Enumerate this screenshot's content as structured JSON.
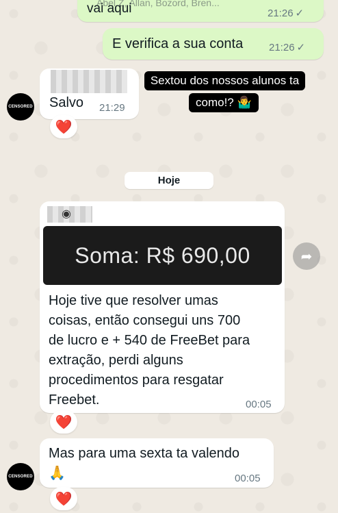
{
  "chat": {
    "top_partial": {
      "names": "Abel Z, Allan, Bozord, Bren...",
      "text": "vai aqui",
      "time": "21:26"
    },
    "out_message": {
      "text": "E verifica a sua conta",
      "time": "21:26"
    },
    "salvo_message": {
      "text": "Salvo",
      "time": "21:29",
      "reaction": "❤️"
    },
    "caption_overlay": {
      "line1": "Sextou dos nossos alunos ta",
      "line2": "como!? 🤷‍♂️"
    },
    "date_divider": "Hoje",
    "media_message": {
      "media_text": "Soma:  R$ 690,00",
      "text_lines": [
        "Hoje tive que resolver umas",
        "coisas, então consegui uns 700",
        "de lucro e + 540 de FreeBet para",
        "extração, perdi alguns",
        "procedimentos para resgatar",
        "Freebet."
      ],
      "time": "00:05",
      "reaction": "❤️"
    },
    "last_message": {
      "text": "Mas para uma sexta ta valendo",
      "emoji": "🙏",
      "time": "00:05",
      "reaction": "❤️"
    },
    "avatar_label": "CENSORED"
  }
}
